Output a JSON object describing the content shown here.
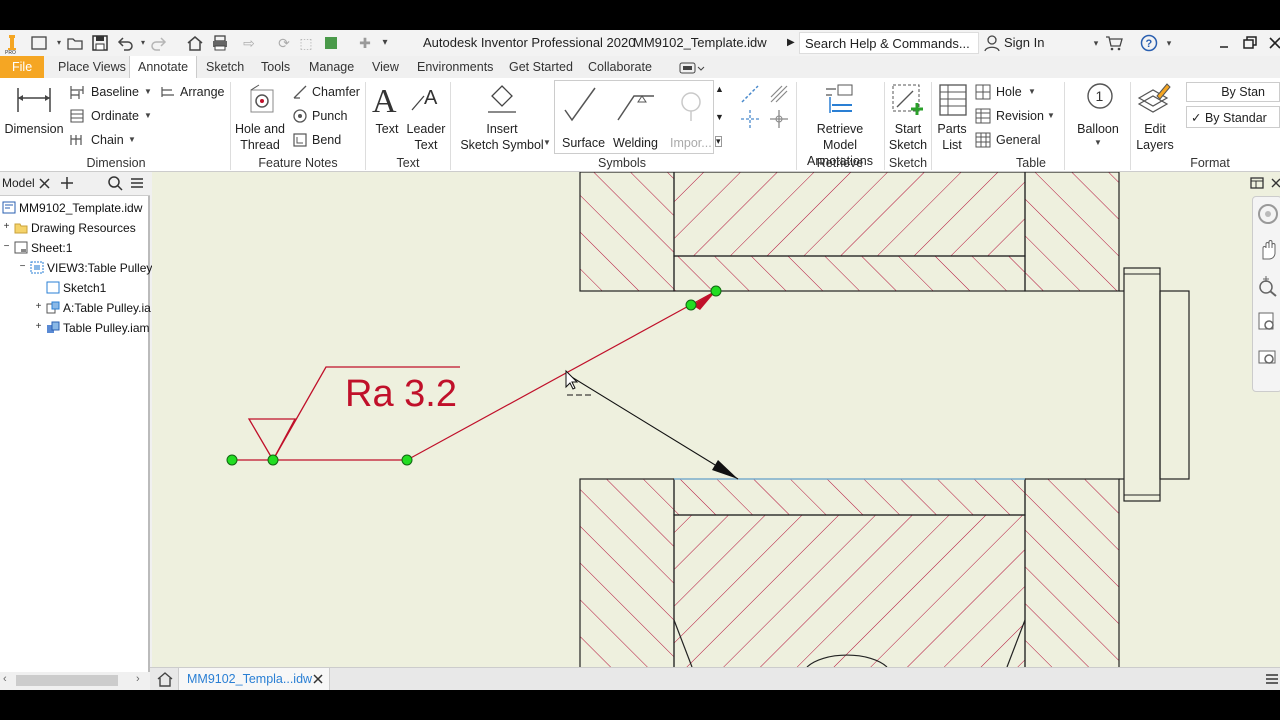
{
  "titlebar": {
    "app_title": "Autodesk Inventor Professional 2020",
    "doc_title": "MM9102_Template.idw",
    "search_placeholder": "Search Help & Commands...",
    "sign_in": "Sign In"
  },
  "tabs": {
    "file": "File",
    "place_views": "Place Views",
    "annotate": "Annotate",
    "sketch": "Sketch",
    "tools": "Tools",
    "manage": "Manage",
    "view": "View",
    "environments": "Environments",
    "get_started": "Get Started",
    "collaborate": "Collaborate"
  },
  "ribbon": {
    "dimension": "Dimension",
    "baseline": "Baseline",
    "arrange": "Arrange",
    "ordinate": "Ordinate",
    "chain": "Chain",
    "group_dimension": "Dimension",
    "hole_thread_1": "Hole and",
    "hole_thread_2": "Thread",
    "chamfer": "Chamfer",
    "punch": "Punch",
    "bend": "Bend",
    "group_feature_notes": "Feature Notes",
    "text": "Text",
    "leader_text_1": "Leader",
    "leader_text_2": "Text",
    "group_text": "Text",
    "insert_sketch_1": "Insert",
    "insert_sketch_2": "Sketch Symbol",
    "surface": "Surface",
    "welding": "Welding",
    "import": "Impor...",
    "group_symbols": "Symbols",
    "retrieve_1": "Retrieve Model",
    "retrieve_2": "Annotations",
    "group_retrieve": "Retrieve",
    "start_sketch_1": "Start",
    "start_sketch_2": "Sketch",
    "group_sketch": "Sketch",
    "parts_list_1": "Parts",
    "parts_list_2": "List",
    "hole": "Hole",
    "revision": "Revision",
    "general": "General",
    "group_table": "Table",
    "balloon": "Balloon",
    "edit_layers_1": "Edit",
    "edit_layers_2": "Layers",
    "by_standard_1": "By Stan",
    "by_standard_2": "By Standar",
    "group_format": "Format"
  },
  "browser": {
    "tab_model": "Model",
    "nodes": [
      "MM9102_Template.idw",
      "Drawing Resources",
      "Sheet:1",
      "VIEW3:Table Pulley.",
      "Sketch1",
      "A:Table Pulley.ia",
      "Table Pulley.iam"
    ]
  },
  "drawing": {
    "symbol_text": "Ra 3.2",
    "balloon_number": "1"
  },
  "docbar": {
    "doc_tab": "MM9102_Templa...idw"
  },
  "colors": {
    "file_tab": "#f5a623",
    "canvas": "#eef0de",
    "annotation_red": "#c0102a",
    "grip_green": "#22dd22"
  }
}
